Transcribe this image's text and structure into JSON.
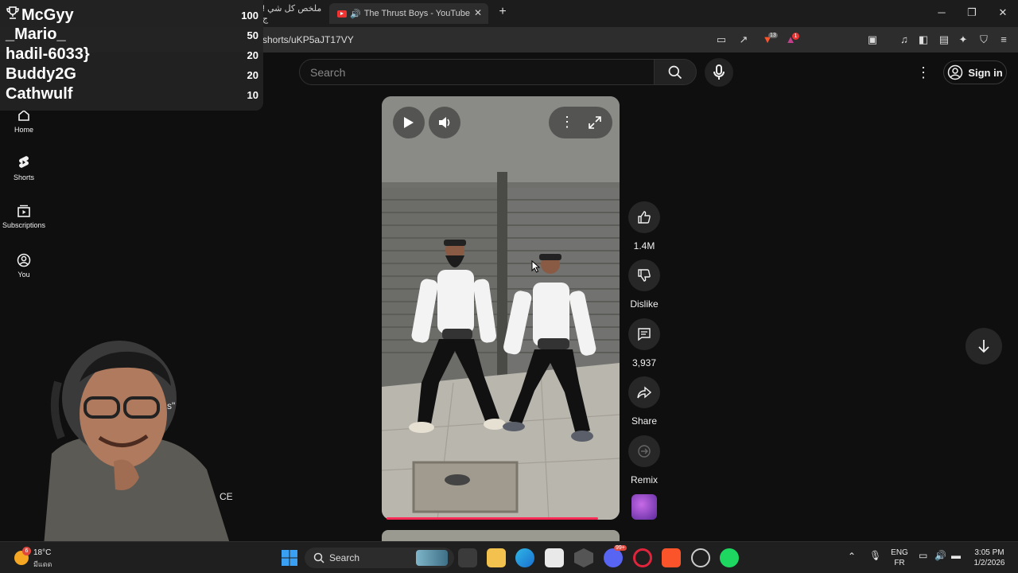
{
  "browser": {
    "tabs": [
      {
        "label": "! ملخص كل شي ج"
      },
      {
        "label": "The Thrust Boys - YouTube"
      }
    ],
    "new_tab": "+",
    "url": "shorts/uKP5aJT17VY",
    "brave_badge": "13",
    "rewards_badge": "1"
  },
  "youtube": {
    "search_placeholder": "Search",
    "sign_in": "Sign in",
    "sidebar": [
      {
        "label": "Home",
        "icon": "home-icon"
      },
      {
        "label": "Shorts",
        "icon": "shorts-icon"
      },
      {
        "label": "Subscriptions",
        "icon": "subscriptions-icon"
      },
      {
        "label": "You",
        "icon": "you-icon"
      }
    ],
    "actions": {
      "like_count": "1.4M",
      "dislike_label": "Dislike",
      "comment_count": "3,937",
      "share_label": "Share",
      "remix_label": "Remix"
    },
    "playback_progress": 0.89
  },
  "leaderboard": [
    {
      "name": "McGyy",
      "score": "100"
    },
    {
      "name": "_Mario_",
      "score": "50"
    },
    {
      "name": "hadil-6033}",
      "score": "20"
    },
    {
      "name": "Buddy2G",
      "score": "20"
    },
    {
      "name": "Cathwulf",
      "score": "10"
    }
  ],
  "overlay_partial": {
    "quote_text": "s\"",
    "ce_text": "CE"
  },
  "taskbar": {
    "weather_temp": "18°C",
    "weather_desc": "มีแดด",
    "weather_badge": "6",
    "search_label": "Search",
    "discord_badge": "99+",
    "lang_top": "ENG",
    "lang_bottom": "FR",
    "time": "3:05 PM",
    "date": "1/2/2026"
  },
  "colors": {
    "youtube_bg": "#0f0f0f",
    "progress": "#ff2a55",
    "brave_orange": "#fb542b"
  }
}
